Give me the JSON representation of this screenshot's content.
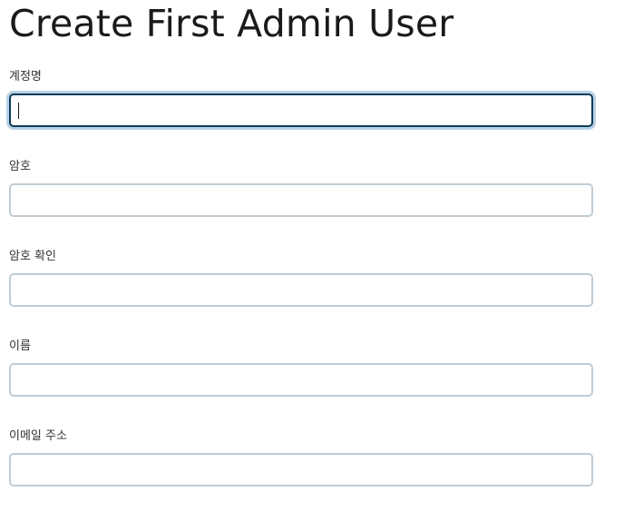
{
  "page": {
    "title": "Create First Admin User"
  },
  "form": {
    "fields": [
      {
        "label": "계정명",
        "value": "",
        "focused": true
      },
      {
        "label": "암호",
        "value": ""
      },
      {
        "label": "암호 확인",
        "value": ""
      },
      {
        "label": "이름",
        "value": ""
      },
      {
        "label": "이메일 주소",
        "value": ""
      }
    ]
  },
  "colors": {
    "focus_border": "#0c3b57",
    "focus_ring": "#b9d2e6",
    "input_border": "#c0ccd4"
  }
}
